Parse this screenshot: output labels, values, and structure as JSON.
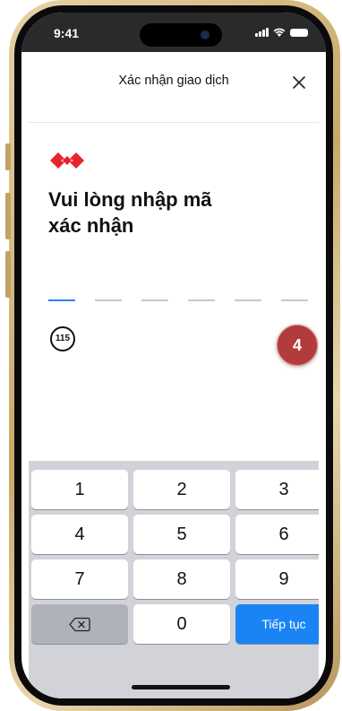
{
  "status_bar": {
    "time": "9:41"
  },
  "header": {
    "title": "Xác nhận giao dịch"
  },
  "content": {
    "headline_line1": "Vui lòng nhập mã",
    "headline_line2": "xác nhận",
    "otp_slots": 6,
    "countdown_seconds": "115",
    "step_badge": "4"
  },
  "keyboard": {
    "keys": [
      "1",
      "2",
      "3",
      "4",
      "5",
      "6",
      "7",
      "8",
      "9"
    ],
    "zero": "0",
    "continue_label": "Tiếp tục"
  },
  "colors": {
    "brand_red": "#e8252c",
    "accent_blue": "#2b86e8",
    "continue_button": "#1a84f5",
    "badge": "#b23b3b"
  }
}
